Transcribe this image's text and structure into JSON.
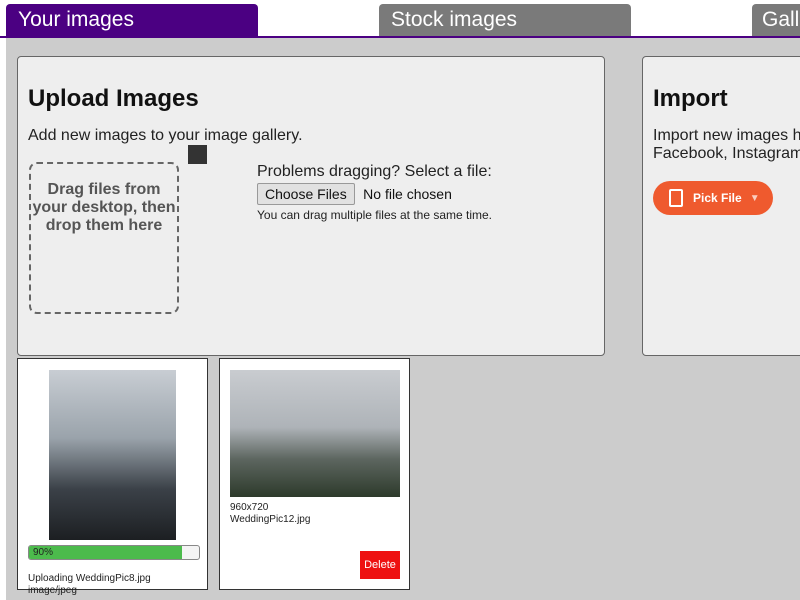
{
  "tabs": {
    "your_images": "Your images",
    "stock_images": "Stock images",
    "gallery": "Gall"
  },
  "upload": {
    "title": "Upload Images",
    "description": "Add new images to your image gallery.",
    "dropzone_text": "Drag files from your desktop, then drop them here",
    "problems": "Problems dragging? Select a file:",
    "choose_button": "Choose Files",
    "no_file": "No file chosen",
    "hint": "You can drag multiple files at the same time."
  },
  "import": {
    "title": "Import",
    "description_line1": "Import new images h",
    "description_line2": "Facebook, Instagram",
    "pick_button": "Pick File"
  },
  "cards": [
    {
      "progress_label": "90%",
      "progress_percent": 90,
      "status": "Uploading WeddingPic8.jpg",
      "mime": "image/jpeg"
    },
    {
      "dimensions": "960x720",
      "filename": "WeddingPic12.jpg",
      "delete_label": "Delete"
    }
  ],
  "colors": {
    "active_tab": "#4b0082",
    "inactive_tab": "#7a7a7a",
    "pick_button": "#ef5a2e",
    "delete_button": "#ee1111",
    "progress": "#4cbb4c"
  }
}
